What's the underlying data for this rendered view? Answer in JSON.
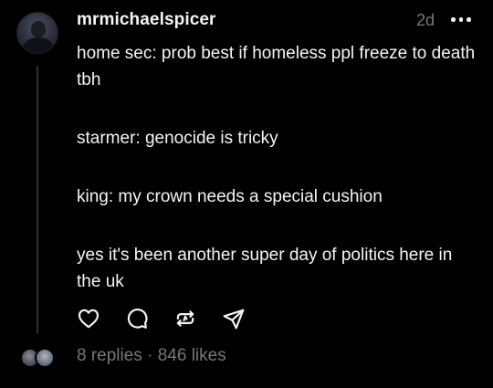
{
  "post": {
    "username": "mrmichaelspicer",
    "time": "2d",
    "paragraphs": [
      "home sec: prob best if homeless ppl freeze to death tbh",
      "starmer: genocide is tricky",
      "king: my crown needs a special cushion",
      "yes it's been another super day of politics here in the uk"
    ]
  },
  "actions": {
    "like_icon": "heart-icon",
    "reply_icon": "comment-icon",
    "repost_icon": "repost-icon",
    "share_icon": "send-icon"
  },
  "footer": {
    "replies": "8 replies",
    "separator": "·",
    "likes": "846 likes"
  },
  "colors": {
    "background": "#000000",
    "text": "#f3f5f7",
    "muted": "#777777",
    "thread_line": "#2e2e2e"
  }
}
